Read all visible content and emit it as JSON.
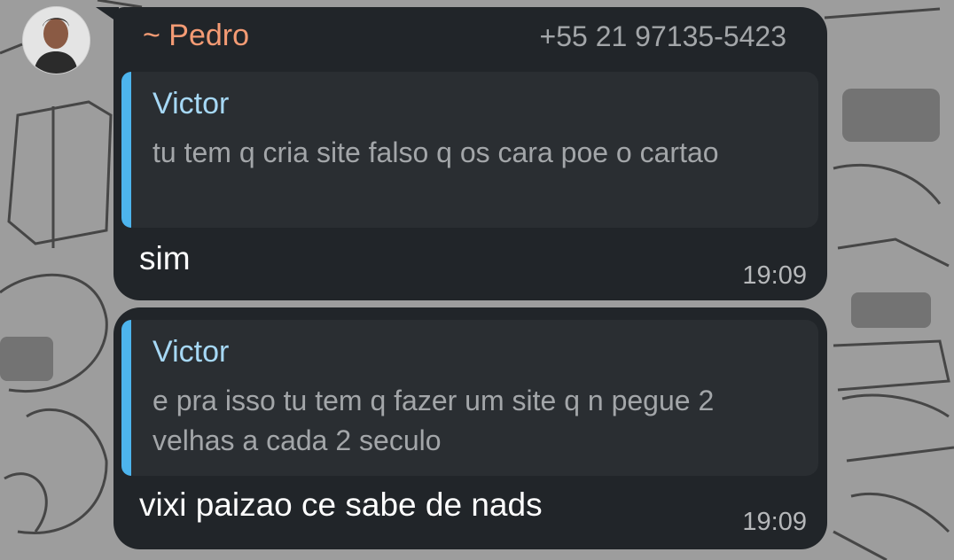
{
  "chat": {
    "sender": {
      "name": "~ Pedro",
      "phone": "+55 21 97135-5423",
      "avatar_icon": "user-photo"
    },
    "messages": [
      {
        "quote": {
          "author": "Victor",
          "text": "tu tem q cria site falso q os cara poe o cartao"
        },
        "text": "sim",
        "time": "19:09"
      },
      {
        "quote": {
          "author": "Victor",
          "text": "e pra isso tu tem q fazer um site q n pegue 2 velhas a cada 2 seculo"
        },
        "text": "vixi paizao ce sabe de nads",
        "time": "19:09"
      }
    ]
  },
  "colors": {
    "bubble": "#212529",
    "quote_bg": "#2a2e32",
    "quote_bar": "#4db4ed",
    "sender_name": "#f49b74",
    "quote_author": "#a6d8f5"
  }
}
